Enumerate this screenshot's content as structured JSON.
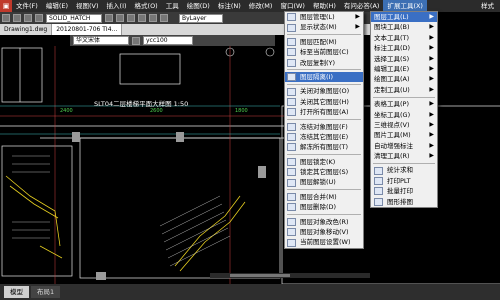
{
  "menubar": {
    "items": [
      {
        "label": "文件(F)"
      },
      {
        "label": "编辑(E)"
      },
      {
        "label": "视图(V)"
      },
      {
        "label": "插入(I)"
      },
      {
        "label": "格式(O)"
      },
      {
        "label": "工具"
      },
      {
        "label": "绘图(D)"
      },
      {
        "label": "标注(N)"
      },
      {
        "label": "修改(M)"
      },
      {
        "label": "窗口(W)"
      },
      {
        "label": "帮助(H)"
      },
      {
        "label": "有问必答(A)"
      },
      {
        "label": "扩展工具(X)",
        "active": true
      }
    ],
    "style_label": "样式"
  },
  "toolbar": {
    "style_combo": "SOLID_HATCH",
    "layer_combo": "ByLayer",
    "font_combo": "华文宋体",
    "layer_name": "ycc100"
  },
  "doc_tabs": [
    {
      "label": "Drawing1.dwg",
      "active": false
    },
    {
      "label": "20120801-706 TI4...",
      "active": true
    }
  ],
  "drawing": {
    "title_label": "SLT04二层楼梯平面大样图 1:50"
  },
  "command_menu": {
    "items": [
      {
        "label": "图层管理(L)",
        "submenu": true
      },
      {
        "label": "显示状态(M)",
        "submenu": true
      },
      "sep",
      {
        "label": "图层匹配(M)"
      },
      {
        "label": "标至当前图层(C)"
      },
      {
        "label": "改层复制(Y)"
      },
      "sep",
      {
        "label": "图层隔离(I)",
        "highlight": true
      },
      "sep",
      {
        "label": "关闭对象图层(O)"
      },
      {
        "label": "关闭其它图层(H)"
      },
      {
        "label": "打开所有图层(A)"
      },
      "sep",
      {
        "label": "冻结对象图层(F)"
      },
      {
        "label": "冻结其它图层(E)"
      },
      {
        "label": "解冻所有图层(T)"
      },
      "sep",
      {
        "label": "图层锁定(K)"
      },
      {
        "label": "锁定其它图层(S)"
      },
      {
        "label": "图层解锁(U)"
      },
      "sep",
      {
        "label": "图层合并(M)"
      },
      {
        "label": "图层删除(D)"
      },
      "sep",
      {
        "label": "图层对象改色(R)"
      },
      {
        "label": "图层对象移动(V)"
      },
      {
        "label": "当前图层设置(W)"
      }
    ]
  },
  "ext_menu": {
    "items": [
      {
        "label": "图层工具(L)",
        "submenu": true,
        "highlight": true
      },
      {
        "label": "图块工具(B)",
        "submenu": true
      },
      {
        "label": "文本工具(T)",
        "submenu": true
      },
      {
        "label": "标注工具(D)",
        "submenu": true
      },
      {
        "label": "选择工具(S)",
        "submenu": true
      },
      {
        "label": "编辑工具(E)",
        "submenu": true
      },
      {
        "label": "绘图工具(A)",
        "submenu": true
      },
      {
        "label": "定制工具(U)",
        "submenu": true
      },
      "sep",
      {
        "label": "表格工具(P)",
        "submenu": true
      },
      {
        "label": "坐标工具(G)",
        "submenu": true
      },
      {
        "label": "三维视点(V)",
        "submenu": true
      },
      {
        "label": "图片工具(M)",
        "submenu": true
      },
      {
        "label": "自动增强标注",
        "submenu": true
      },
      {
        "label": "清理工具(R)",
        "submenu": true
      },
      "sep",
      {
        "label": "统计求和"
      },
      {
        "label": "打印PLT"
      },
      {
        "label": "批量打印"
      },
      {
        "label": "图形排图"
      }
    ]
  },
  "bottom_tabs": [
    {
      "label": "模型",
      "active": true
    },
    {
      "label": "布局1",
      "active": false
    }
  ],
  "colors": {
    "menu_highlight": "#3a6fc4",
    "cad_background": "#000000"
  }
}
